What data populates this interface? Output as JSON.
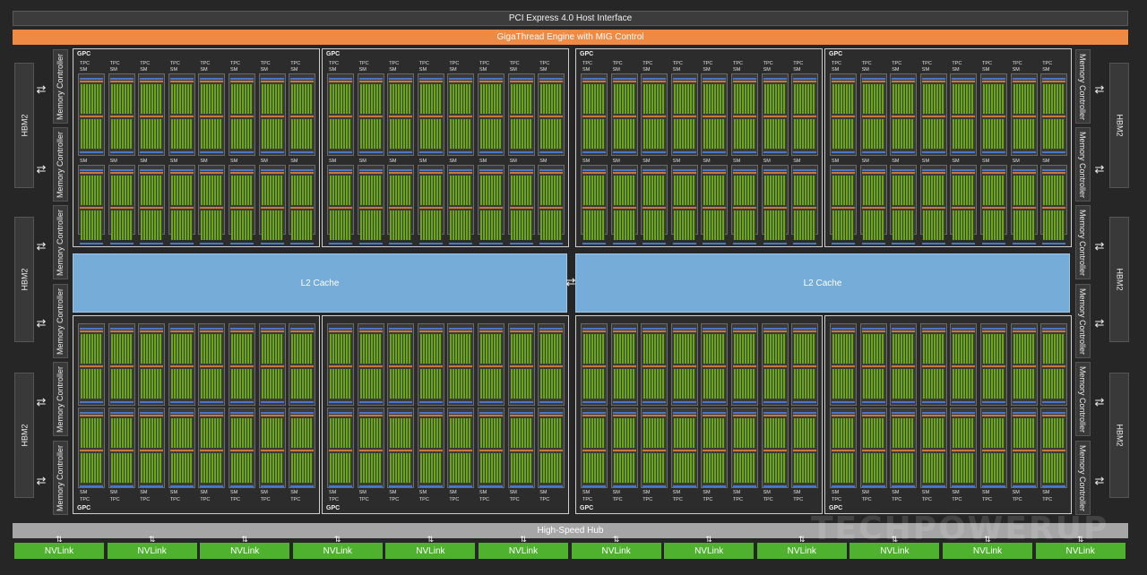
{
  "title_bar": "PCI Express 4.0 Host Interface",
  "giga_bar": "GigaThread Engine with MIG Control",
  "hub_bar": "High-Speed Hub",
  "hbm_label": "HBM2",
  "mc_label": "Memory Controller",
  "l2_label": "L2 Cache",
  "gpc_label": "GPC",
  "tpc_label": "TPC",
  "sm_label": "SM",
  "nvlink_label": "NVLink",
  "nvlink_count": 12,
  "gpc_count": 8,
  "tpc_per_gpc": 8,
  "sm_per_tpc": 2,
  "watermark": "TECHPOWERUP",
  "colors": {
    "giga": "#ef8a45",
    "l2": "#75acd8",
    "nvlink": "#4fb22e",
    "hub": "#a6a6a6",
    "core": "#6fa21e"
  }
}
